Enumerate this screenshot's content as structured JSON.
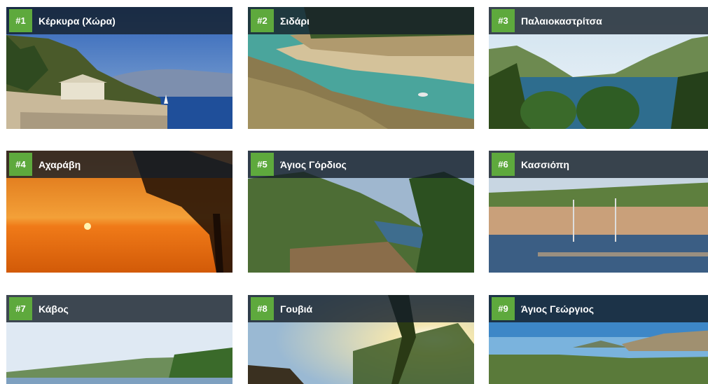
{
  "destinations": [
    {
      "rank": "#1",
      "name": "Κέρκυρα (Χώρα)"
    },
    {
      "rank": "#2",
      "name": "Σιδάρι"
    },
    {
      "rank": "#3",
      "name": "Παλαιοκαστρίτσα"
    },
    {
      "rank": "#4",
      "name": "Αχαράβη"
    },
    {
      "rank": "#5",
      "name": "Άγιος Γόρδιος"
    },
    {
      "rank": "#6",
      "name": "Κασσιόπη"
    },
    {
      "rank": "#7",
      "name": "Κάβος"
    },
    {
      "rank": "#8",
      "name": "Γουβιά"
    },
    {
      "rank": "#9",
      "name": "Άγιος Γεώργιος"
    }
  ],
  "colors": {
    "rank_badge": "#5ea93d",
    "header_overlay": "rgba(20,30,40,0.80)",
    "label_text": "#ffffff"
  }
}
